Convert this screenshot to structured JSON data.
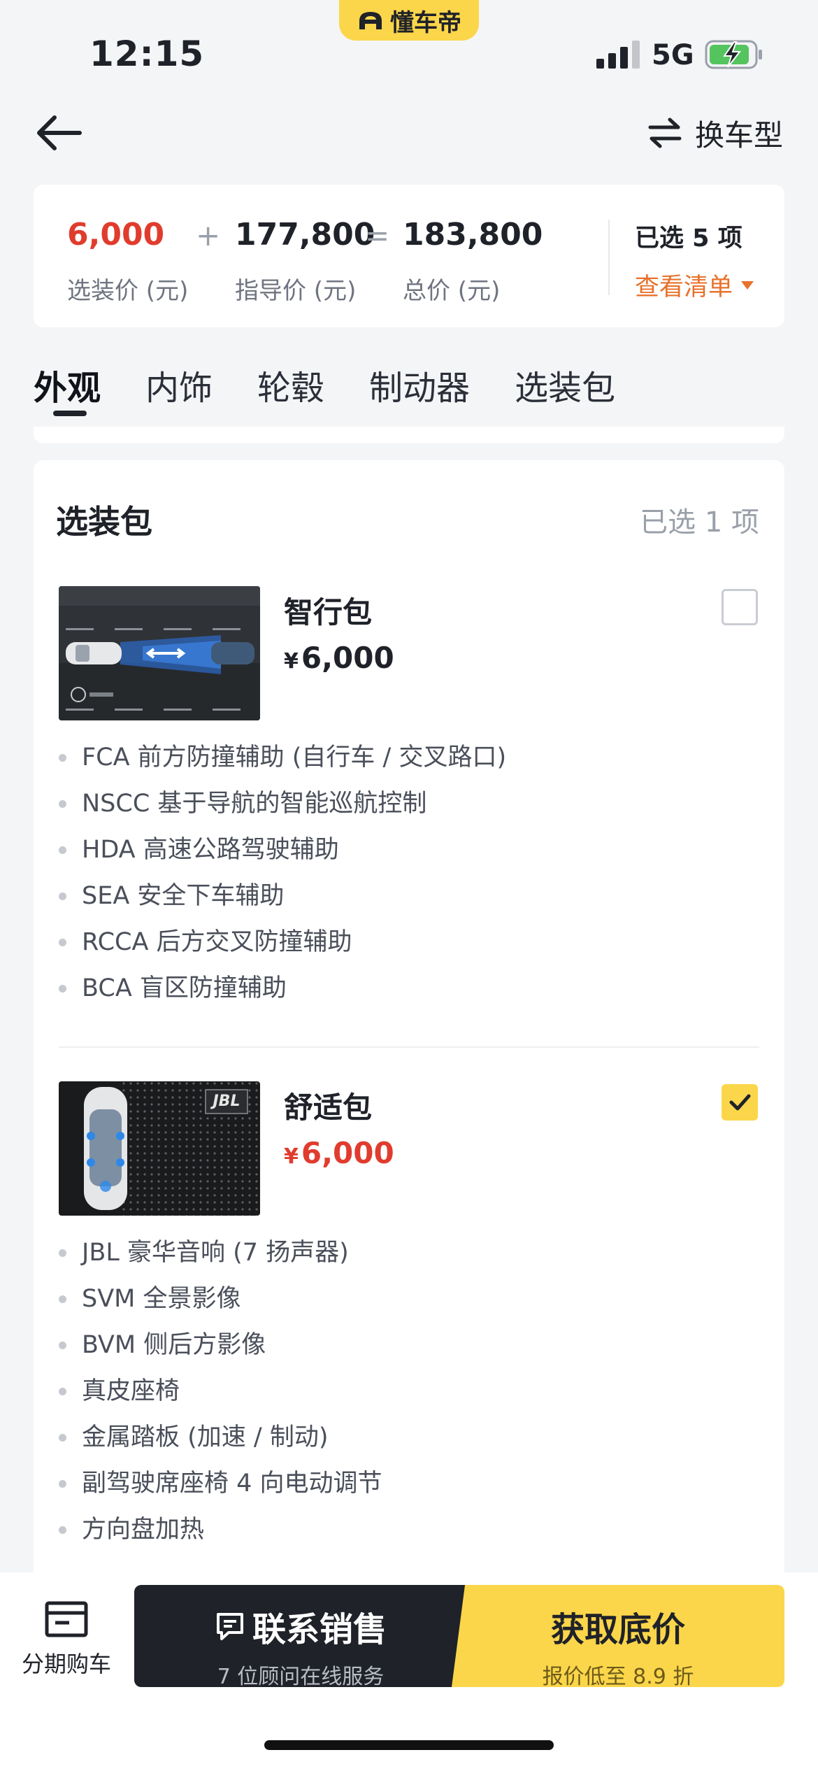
{
  "status_bar": {
    "time": "12:15",
    "network": "5G",
    "app_badge": "懂车帝"
  },
  "nav": {
    "switch_label": "换车型"
  },
  "price_summary": {
    "option_price": "6,000",
    "option_caption": "选装价 (元)",
    "plus": "+",
    "msrp": "177,800",
    "msrp_caption": "指导价 (元)",
    "equals": "=",
    "total": "183,800",
    "total_caption": "总价 (元)",
    "selected_count": "已选 5 项",
    "view_list": "查看清单"
  },
  "tabs": [
    {
      "label": "外观",
      "active": true
    },
    {
      "label": "内饰"
    },
    {
      "label": "轮毂"
    },
    {
      "label": "制动器"
    },
    {
      "label": "选装包"
    }
  ],
  "section": {
    "title": "选装包",
    "count": "已选 1 项"
  },
  "packages": [
    {
      "name": "智行包",
      "currency": "¥",
      "price": "6,000",
      "checked": false,
      "thumb_icon": "driving-assist-image",
      "features": [
        "FCA 前方防撞辅助 (自行车 / 交叉路口)",
        "NSCC 基于导航的智能巡航控制",
        "HDA 高速公路驾驶辅助",
        "SEA 安全下车辅助",
        "RCCA 后方交叉防撞辅助",
        "BCA 盲区防撞辅助"
      ]
    },
    {
      "name": "舒适包",
      "currency": "¥",
      "price": "6,000",
      "checked": true,
      "thumb_icon": "jbl-audio-image",
      "thumb_text": "JBL",
      "features": [
        "JBL 豪华音响 (7 扬声器)",
        "SVM 全景影像",
        "BVM 侧后方影像",
        "真皮座椅",
        "金属踏板 (加速 / 制动)",
        "副驾驶席座椅 4 向电动调节",
        "方向盘加热"
      ]
    }
  ],
  "bottom_bar": {
    "installment_label": "分期购车",
    "contact_main": "联系销售",
    "contact_sub": "7 位顾问在线服务",
    "price_main": "获取底价",
    "price_sub": "报价低至 8.9 折"
  },
  "colors": {
    "accent_yellow": "#fcd64a",
    "price_red": "#e03c2e",
    "link_orange": "#e8712b",
    "dark": "#1f2229"
  }
}
